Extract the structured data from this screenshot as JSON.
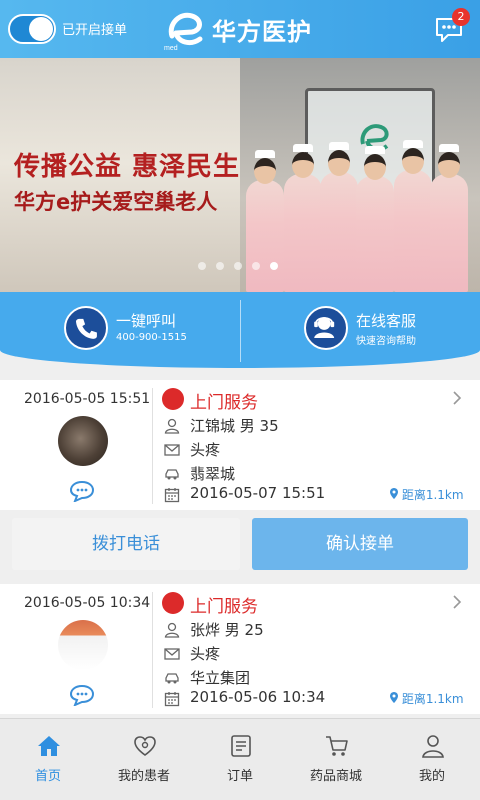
{
  "header": {
    "toggle_label": "已开启接单",
    "toggle_on": true,
    "brand": "华方医护",
    "message_badge": "2"
  },
  "banner": {
    "title": "传播公益 惠泽民生",
    "subtitle": "华方e护关爱空巢老人",
    "slide_count": 5,
    "active_slide": 4
  },
  "quick_actions": {
    "call": {
      "label": "一键呼叫",
      "sub": "400-900-1515"
    },
    "service": {
      "label": "在线客服",
      "sub": "快速咨询帮助"
    }
  },
  "orders": [
    {
      "time": "2016-05-05 15:51",
      "service": "上门服务",
      "patient": "江锦城  男  35",
      "symptom": "头疼",
      "address": "翡翠城",
      "appointment": "2016-05-07 15:51",
      "distance": "距离1.1km"
    },
    {
      "time": "2016-05-05 10:34",
      "service": "上门服务",
      "patient": "张烨  男  25",
      "symptom": "头疼",
      "address": "华立集团",
      "appointment": "2016-05-06 10:34",
      "distance": "距离1.1km"
    }
  ],
  "actions": {
    "call": "拨打电话",
    "confirm": "确认接单"
  },
  "nav": [
    {
      "label": "首页",
      "icon": "home-icon",
      "active": true
    },
    {
      "label": "我的患者",
      "icon": "heart-user-icon",
      "active": false
    },
    {
      "label": "订单",
      "icon": "order-list-icon",
      "active": false
    },
    {
      "label": "药品商城",
      "icon": "cart-icon",
      "active": false
    },
    {
      "label": "我的",
      "icon": "person-icon",
      "active": false
    }
  ],
  "colors": {
    "header": "#3aa0e6",
    "accent": "#2f8fe0",
    "service_red": "#dc2a2a",
    "confirm_button": "#6cb5ec"
  }
}
